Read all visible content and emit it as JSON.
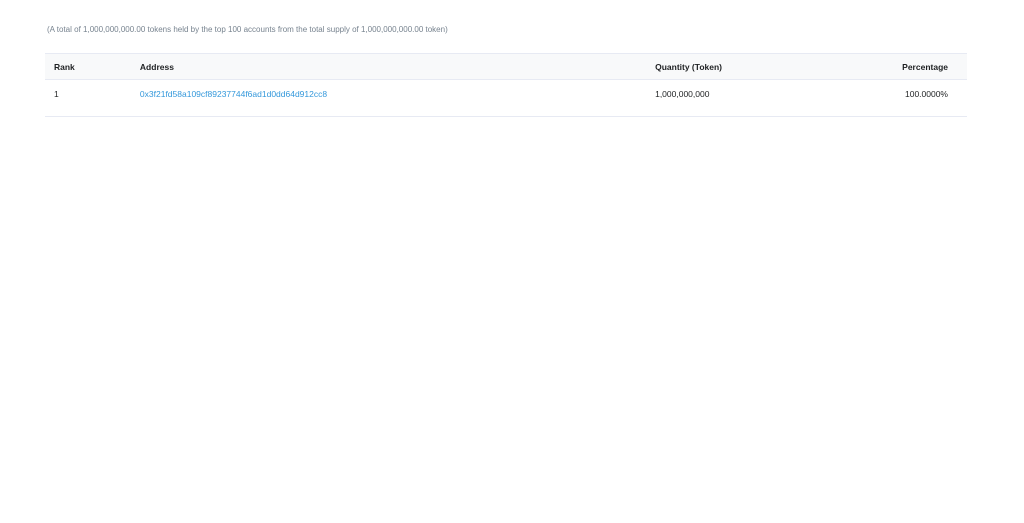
{
  "summary": {
    "text": "(A total of 1,000,000,000.00 tokens held by the top 100 accounts from the total supply of 1,000,000,000.00 token)"
  },
  "table": {
    "columns": {
      "rank": "Rank",
      "address": "Address",
      "quantity": "Quantity (Token)",
      "percentage": "Percentage"
    },
    "rows": [
      {
        "rank": "1",
        "address": "0x3f21fd58a109cf89237744f6ad1d0dd64d912cc8",
        "quantity": "1,000,000,000",
        "percentage": "100.0000%"
      }
    ]
  },
  "colors": {
    "link": "#3498db",
    "muted_text": "#77838f",
    "header_bg": "#f8f9fa",
    "border": "#e7eaf3"
  }
}
